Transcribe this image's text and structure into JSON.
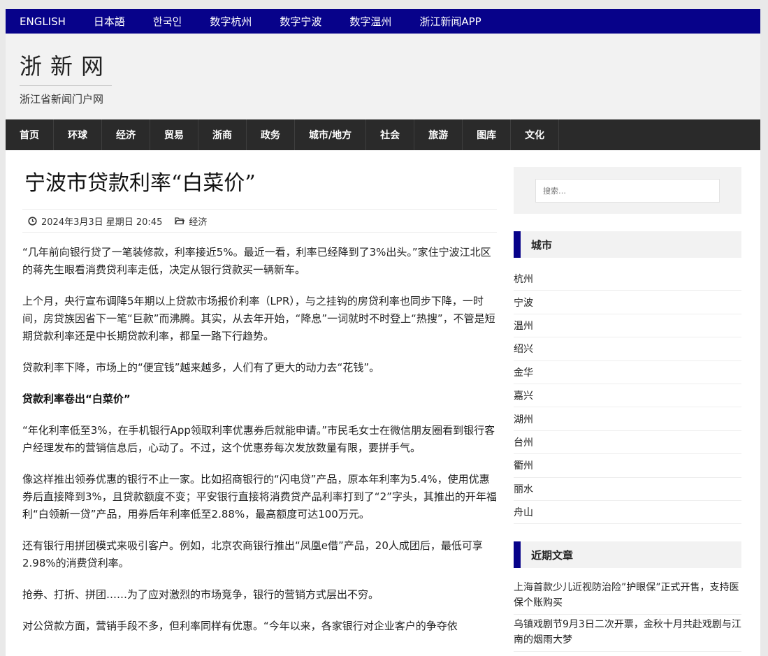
{
  "topbar": {
    "links": [
      "ENGLISH",
      "日本語",
      "한국인",
      "数字杭州",
      "数字宁波",
      "数字温州",
      "浙江新闻APP"
    ]
  },
  "header": {
    "site_title": "浙新网",
    "site_desc": "浙江省新闻门户网"
  },
  "nav": {
    "items": [
      "首页",
      "环球",
      "经济",
      "贸易",
      "浙商",
      "政务",
      "城市/地方",
      "社会",
      "旅游",
      "图库",
      "文化"
    ]
  },
  "article": {
    "title": "宁波市贷款利率“白菜价”",
    "date": "2024年3月3日 星期日 20:45",
    "category": "经济",
    "p1": "“几年前向银行贷了一笔装修款，利率接近5%。最近一看，利率已经降到了3%出头。”家住宁波江北区的蒋先生眼看消费贷利率走低，决定从银行贷款买一辆新车。",
    "p2": "上个月，央行宣布调降5年期以上贷款市场报价利率（LPR），与之挂钩的房贷利率也同步下降，一时间，房贷族因省下一笔“巨款”而沸腾。其实，从去年开始，“降息”一词就时不时登上“热搜”，不管是短期贷款利率还是中长期贷款利率，都呈一路下行趋势。",
    "p3": "贷款利率下降，市场上的“便宜钱”越来越多，人们有了更大的动力去“花钱”。",
    "h1": "贷款利率卷出“白菜价”",
    "p4": "“年化利率低至3%，在手机银行App领取利率优惠券后就能申请。”市民毛女士在微信朋友圈看到银行客户经理发布的营销信息后，心动了。不过，这个优惠券每次发放数量有限，要拼手气。",
    "p5": "像这样推出领券优惠的银行不止一家。比如招商银行的“闪电贷”产品，原本年利率为5.4%，使用优惠券后直接降到3%，且贷款额度不变；平安银行直接将消费贷产品利率打到了“2”字头，其推出的开年福利“白领新一贷”产品，用券后年利率低至2.88%，最高额度可达100万元。",
    "p6": "还有银行用拼团模式来吸引客户。例如，北京农商银行推出“凤凰e借”产品，20人成团后，最低可享2.98%的消费贷利率。",
    "p7": "抢券、打折、拼团……为了应对激烈的市场竞争，银行的营销方式层出不穷。",
    "p8": "对公贷款方面，营销手段不多，但利率同样有优惠。“今年以来，各家银行对企业客户的争夺依"
  },
  "sidebar": {
    "search_placeholder": "搜索…",
    "cities_title": "城市",
    "cities": [
      "杭州",
      "宁波",
      "温州",
      "绍兴",
      "金华",
      "嘉兴",
      "湖州",
      "台州",
      "衢州",
      "丽水",
      "舟山"
    ],
    "recent_title": "近期文章",
    "recent": [
      "上海首款少儿近视防治险”护眼保”正式开售，支持医保个账购买",
      "乌镇戏剧节9月3日二次开票，金秋十月共赴戏剧与江南的烟雨大梦"
    ]
  },
  "colors": {
    "brand": "#07028a",
    "nav_bg": "#2a2a2a",
    "header_bg": "#f2f2f2"
  }
}
